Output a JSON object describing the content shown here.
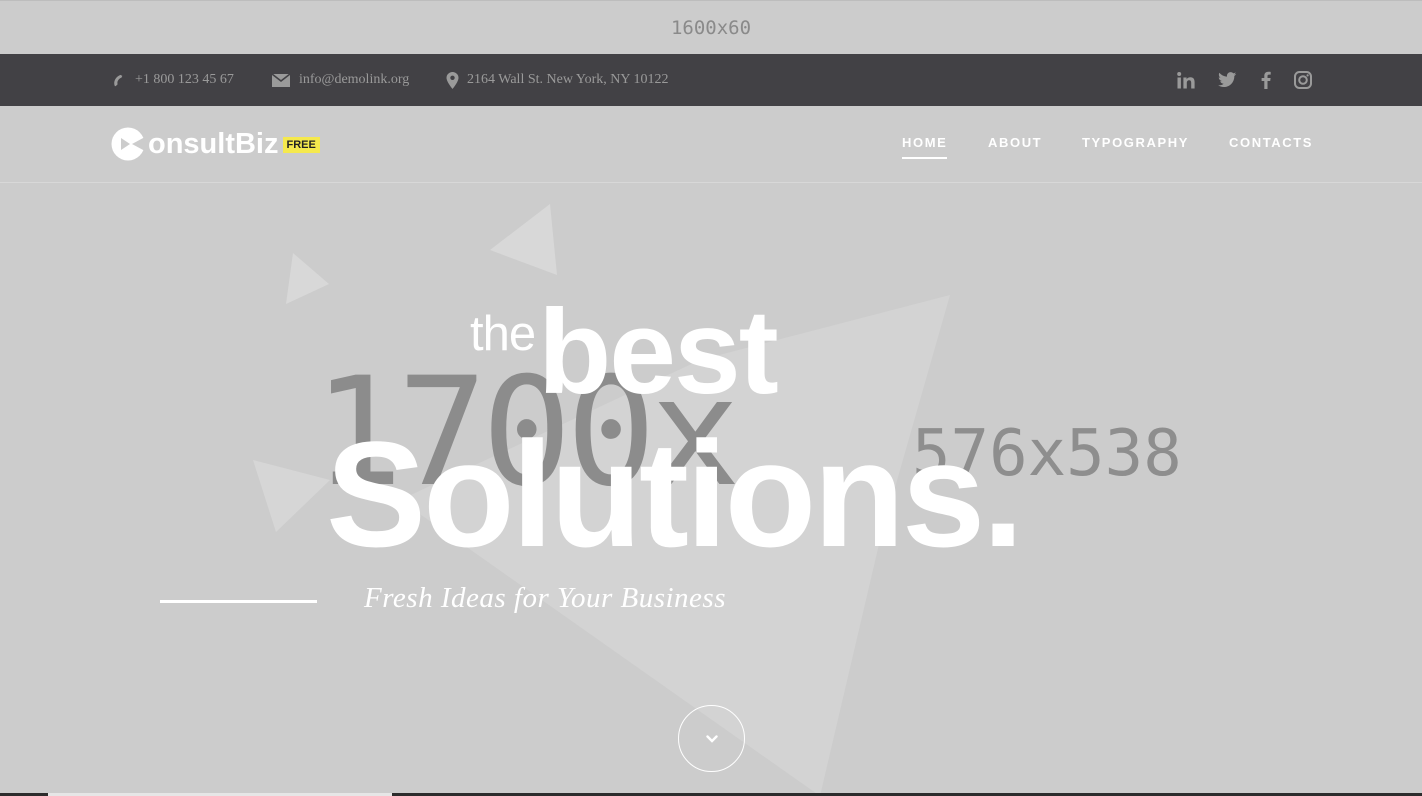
{
  "promo_banner": {
    "text": "1600x60"
  },
  "topbar": {
    "phone": "+1 800 123 45 67",
    "email": "info@demolink.org",
    "address": "2164 Wall St. New York, NY 10122",
    "social_icons": [
      "linkedin-icon",
      "twitter-icon",
      "facebook-icon",
      "instagram-icon"
    ]
  },
  "brand": {
    "logo_text": "onsultBiz",
    "badge": "FREE"
  },
  "nav": {
    "items": [
      {
        "label": "HOME",
        "active": true
      },
      {
        "label": "ABOUT",
        "active": false
      },
      {
        "label": "TYPOGRAPHY",
        "active": false
      },
      {
        "label": "CONTACTS",
        "active": false
      }
    ]
  },
  "hero": {
    "the": "the",
    "best": "best",
    "solutions": "Solutions.",
    "tagline": "Fresh Ideas for Your Business",
    "placeholder_large": "1700x",
    "placeholder_small": "576x538",
    "scroll_icon": "chevron-down-icon"
  },
  "colors": {
    "page_background": "#cccccc",
    "topbar_background": "#424145",
    "badge_background": "#f5e94d",
    "text_light": "#ffffff",
    "text_muted": "#9a9a9a"
  }
}
